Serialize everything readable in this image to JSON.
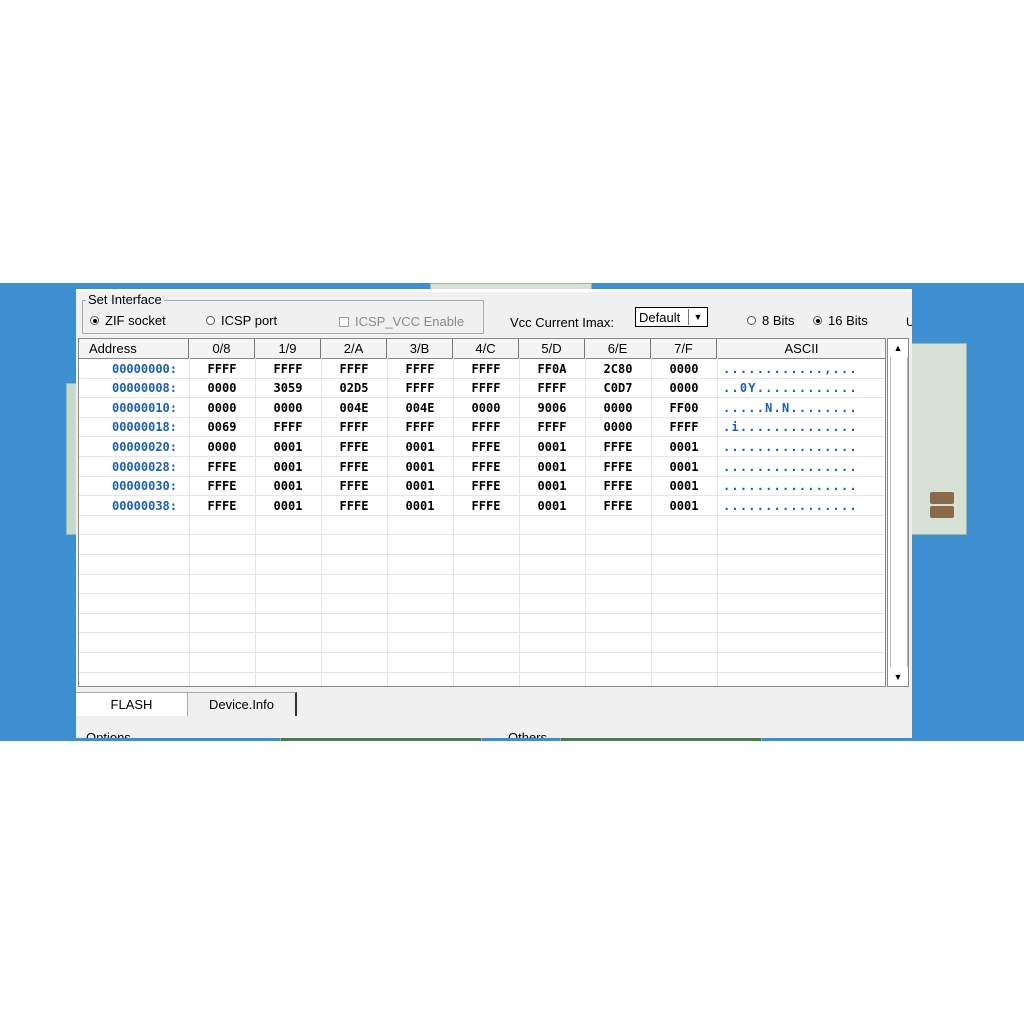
{
  "interface": {
    "group_title": "Set Interface",
    "options": [
      {
        "label": "ZIF socket",
        "selected": true
      },
      {
        "label": "ICSP port",
        "selected": false
      }
    ],
    "icsp_vcc": {
      "label": "ICSP_VCC Enable",
      "checked": false,
      "enabled": false
    }
  },
  "vcc": {
    "label": "Vcc Current Imax:",
    "value": "Default"
  },
  "bits": {
    "options": [
      {
        "label": "8 Bits",
        "selected": false
      },
      {
        "label": "16 Bits",
        "selected": true
      }
    ],
    "cut_text": "U"
  },
  "grid": {
    "columns": [
      "Address",
      "0/8",
      "1/9",
      "2/A",
      "3/B",
      "4/C",
      "5/D",
      "6/E",
      "7/F",
      "ASCII"
    ],
    "rows": [
      {
        "address": "00000000:",
        "words": [
          "FFFF",
          "FFFF",
          "FFFF",
          "FFFF",
          "FFFF",
          "FF0A",
          "2C80",
          "0000"
        ],
        "ascii": "............,..."
      },
      {
        "address": "00000008:",
        "words": [
          "0000",
          "3059",
          "02D5",
          "FFFF",
          "FFFF",
          "FFFF",
          "C0D7",
          "0000"
        ],
        "ascii": "..0Y............"
      },
      {
        "address": "00000010:",
        "words": [
          "0000",
          "0000",
          "004E",
          "004E",
          "0000",
          "9006",
          "0000",
          "FF00"
        ],
        "ascii": ".....N.N........"
      },
      {
        "address": "00000018:",
        "words": [
          "0069",
          "FFFF",
          "FFFF",
          "FFFF",
          "FFFF",
          "FFFF",
          "0000",
          "FFFF"
        ],
        "ascii": ".i.............."
      },
      {
        "address": "00000020:",
        "words": [
          "0000",
          "0001",
          "FFFE",
          "0001",
          "FFFE",
          "0001",
          "FFFE",
          "0001"
        ],
        "ascii": "................"
      },
      {
        "address": "00000028:",
        "words": [
          "FFFE",
          "0001",
          "FFFE",
          "0001",
          "FFFE",
          "0001",
          "FFFE",
          "0001"
        ],
        "ascii": "................"
      },
      {
        "address": "00000030:",
        "words": [
          "FFFE",
          "0001",
          "FFFE",
          "0001",
          "FFFE",
          "0001",
          "FFFE",
          "0001"
        ],
        "ascii": "................"
      },
      {
        "address": "00000038:",
        "words": [
          "FFFE",
          "0001",
          "FFFE",
          "0001",
          "FFFE",
          "0001",
          "FFFE",
          "0001"
        ],
        "ascii": "................"
      }
    ]
  },
  "tabs": [
    {
      "label": "FLASH",
      "active": true
    },
    {
      "label": "Device.Info",
      "active": false
    }
  ],
  "lower_groups": [
    "Options",
    "Others"
  ],
  "colors": {
    "address_text": "#1a5fb4",
    "ascii_text": "#1a5fb4",
    "background_photo": "#3d8fd0"
  }
}
